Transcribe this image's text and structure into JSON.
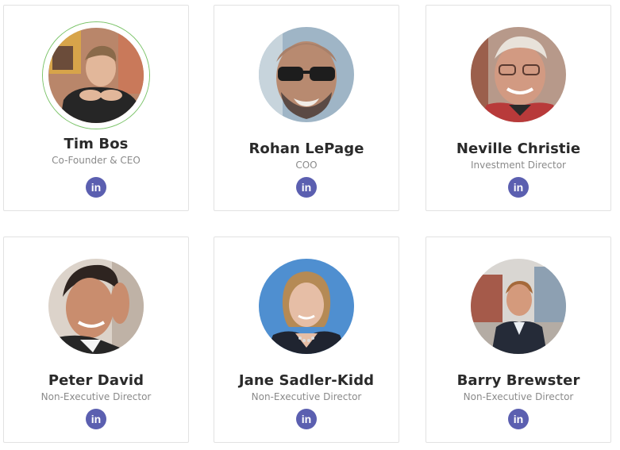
{
  "team": [
    {
      "name": "Tim Bos",
      "role": "Co-Founder & CEO",
      "linkedin_label": "in",
      "avatar_icon": "person-photo-icon"
    },
    {
      "name": "Rohan LePage",
      "role": "COO",
      "linkedin_label": "in",
      "avatar_icon": "person-photo-icon"
    },
    {
      "name": "Neville Christie",
      "role": "Investment Director",
      "linkedin_label": "in",
      "avatar_icon": "person-photo-icon"
    },
    {
      "name": "Peter David",
      "role": "Non-Executive Director",
      "linkedin_label": "in",
      "avatar_icon": "person-photo-icon"
    },
    {
      "name": "Jane Sadler-Kidd",
      "role": "Non-Executive Director",
      "linkedin_label": "in",
      "avatar_icon": "person-photo-icon"
    },
    {
      "name": "Barry Brewster",
      "role": "Non-Executive Director",
      "linkedin_label": "in",
      "avatar_icon": "person-photo-icon"
    }
  ],
  "colors": {
    "linkedin": "#5b5fb0",
    "highlight_ring": "#7cc46a",
    "name": "#2a2a2a",
    "role": "#8a8a8a"
  }
}
